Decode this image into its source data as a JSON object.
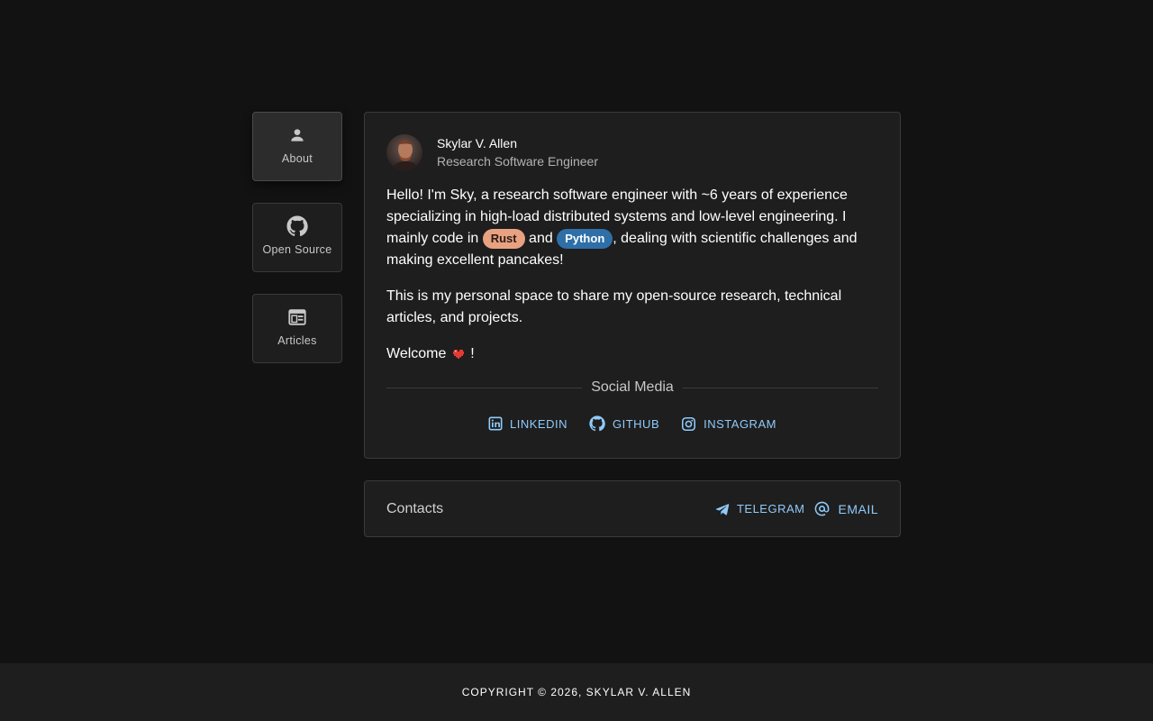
{
  "nav": {
    "items": [
      {
        "label": "About",
        "icon": "person-icon",
        "active": true
      },
      {
        "label": "Open Source",
        "icon": "github-icon",
        "active": false
      },
      {
        "label": "Articles",
        "icon": "article-icon",
        "active": false
      }
    ]
  },
  "profile": {
    "name": "Skylar V. Allen",
    "role": "Research Software Engineer",
    "bio": {
      "p1_part1": "Hello! I'm Sky, a research software engineer with ~6 years of experience specializing in high-load distributed systems and low-level engineering. I mainly code in ",
      "chip_rust": "Rust",
      "p1_and": " and ",
      "chip_python": "Python",
      "p1_part2": ", dealing with scientific challenges and making excellent pancakes!",
      "p2": "This is my personal space to share my open-source research, technical articles, and projects.",
      "p3_welcome": "Welcome ",
      "p3_end": " !"
    },
    "social_heading": "Social Media",
    "social": [
      {
        "label": "LINKEDIN",
        "icon": "linkedin-icon"
      },
      {
        "label": "GITHUB",
        "icon": "github-icon"
      },
      {
        "label": "INSTAGRAM",
        "icon": "instagram-icon"
      }
    ]
  },
  "contacts": {
    "title": "Contacts",
    "telegram": "TELEGRAM",
    "email": "EMAIL"
  },
  "footer": {
    "copyright": "COPYRIGHT © 2026, SKYLAR V. ALLEN"
  },
  "colors": {
    "background": "#121212",
    "surface": "#1e1e1e",
    "link": "#90caf9",
    "rust_chip": "#e8a282",
    "python_chip": "#2e6fa8"
  }
}
